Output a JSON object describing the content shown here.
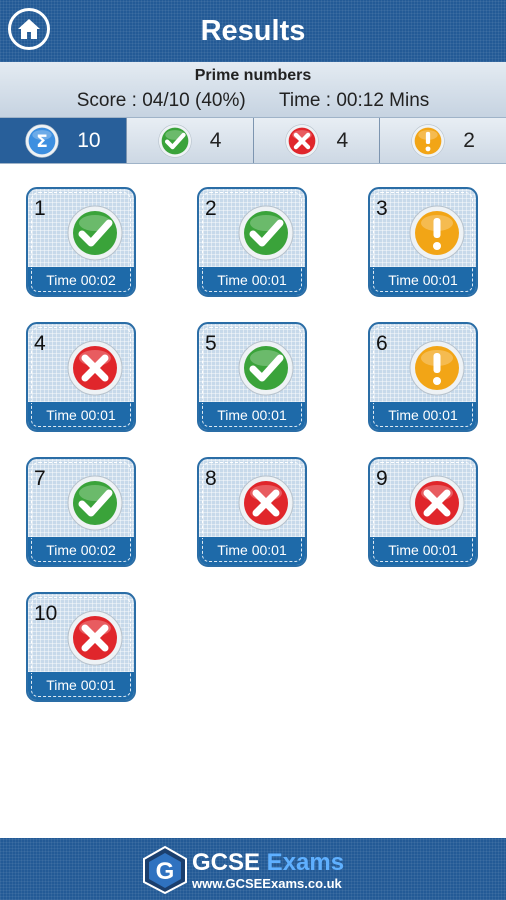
{
  "header": {
    "title": "Results",
    "home_icon": "home-icon"
  },
  "summary": {
    "quiz_name": "Prime numbers",
    "score": "Score : 04/10 (40%)",
    "time": "Time : 00:12 Mins"
  },
  "tabs": [
    {
      "icon": "sigma-icon",
      "count": "10",
      "active": true
    },
    {
      "icon": "check-icon",
      "count": "4",
      "active": false
    },
    {
      "icon": "cross-icon",
      "count": "4",
      "active": false
    },
    {
      "icon": "exclamation-icon",
      "count": "2",
      "active": false
    }
  ],
  "questions": [
    {
      "number": "1",
      "status": "correct",
      "time": "Time 00:02"
    },
    {
      "number": "2",
      "status": "correct",
      "time": "Time 00:01"
    },
    {
      "number": "3",
      "status": "skipped",
      "time": "Time 00:01"
    },
    {
      "number": "4",
      "status": "incorrect",
      "time": "Time 00:01"
    },
    {
      "number": "5",
      "status": "correct",
      "time": "Time 00:01"
    },
    {
      "number": "6",
      "status": "skipped",
      "time": "Time 00:01"
    },
    {
      "number": "7",
      "status": "correct",
      "time": "Time 00:02"
    },
    {
      "number": "8",
      "status": "incorrect",
      "time": "Time 00:01"
    },
    {
      "number": "9",
      "status": "incorrect",
      "time": "Time 00:01"
    },
    {
      "number": "10",
      "status": "incorrect",
      "time": "Time 00:01"
    }
  ],
  "footer": {
    "brand_part1": "GCSE",
    "brand_part2": " Exams",
    "url": "www.GCSEExams.co.uk"
  },
  "colors": {
    "header_bg": "#235a96",
    "correct": "#3aa33a",
    "incorrect": "#e0262b",
    "skipped": "#f2a516",
    "sigma": "#3d8fe0"
  }
}
